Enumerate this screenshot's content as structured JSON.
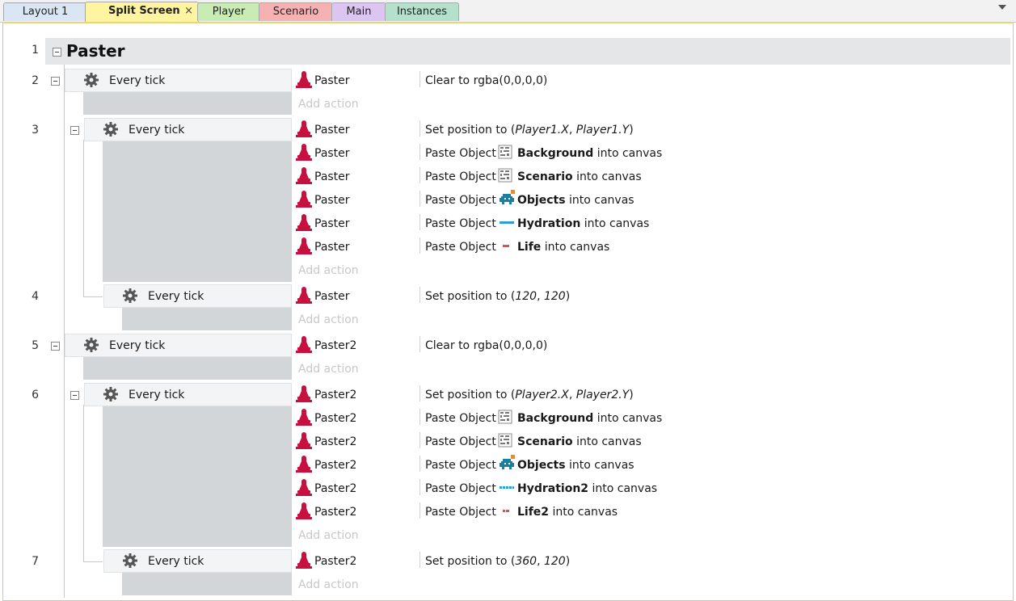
{
  "tabs": [
    {
      "label": "Layout 1",
      "color": "#dbe6f4"
    },
    {
      "label": "Split Screen",
      "color": "#fff5a0",
      "active": true,
      "close": "×"
    },
    {
      "label": "Player",
      "color": "#c9ecb4"
    },
    {
      "label": "Scenario",
      "color": "#f6b2b2"
    },
    {
      "label": "Main",
      "color": "#dcc6f1"
    },
    {
      "label": "Instances",
      "color": "#b4e0cc"
    }
  ],
  "group": {
    "line": "1",
    "title": "Paster"
  },
  "lines": [
    "2",
    "3",
    "4",
    "5",
    "6",
    "7"
  ],
  "condition_label": "Every tick",
  "add_action_label": "Add action",
  "objects": {
    "paster": "Paster",
    "paster2": "Paster2"
  },
  "verbs": {
    "clear": "Clear to rgba(0,0,0,0)",
    "set_position": "Set position to",
    "paste": "Paste Object",
    "into_canvas": "into canvas"
  },
  "params": {
    "p1x": "Player1.X",
    "p1y": "Player1.Y",
    "p2x": "Player2.X",
    "p2y": "Player2.Y",
    "c120": "120",
    "c120b": "120",
    "c360": "360",
    "c120c": "120"
  },
  "layers": {
    "background": "Background",
    "scenario": "Scenario",
    "objects": "Objects",
    "hydration": "Hydration",
    "life": "Life",
    "hydration2": "Hydration2",
    "life2": "Life2"
  },
  "colors": {
    "stamp": "#c8103e",
    "accent_frame": "#e6d57a"
  }
}
